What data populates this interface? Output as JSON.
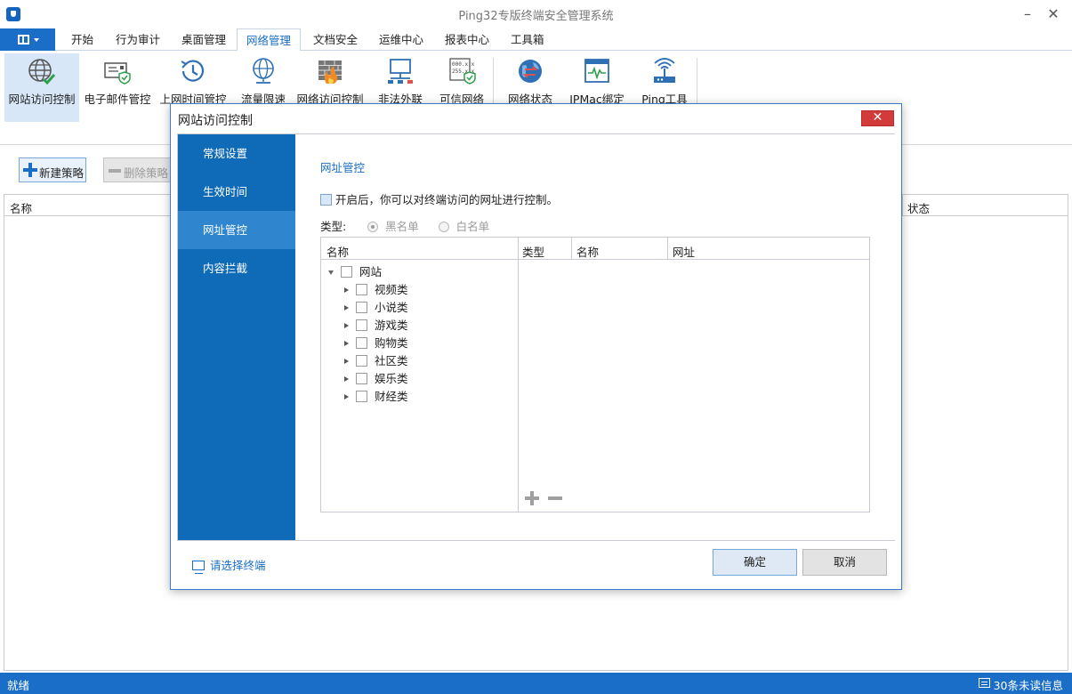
{
  "window": {
    "title": "Ping32专版终端安全管理系统",
    "minimize": "–",
    "close": "✕"
  },
  "menu": {
    "tabs": [
      {
        "label": "开始"
      },
      {
        "label": "行为审计"
      },
      {
        "label": "桌面管理"
      },
      {
        "label": "网络管理"
      },
      {
        "label": "文档安全"
      },
      {
        "label": "运维中心"
      },
      {
        "label": "报表中心"
      },
      {
        "label": "工具箱"
      }
    ],
    "active_tab": "网络管理"
  },
  "ribbon": {
    "items": [
      {
        "label": "网站访问控制",
        "icon": "globe-check-icon"
      },
      {
        "label": "电子邮件管控",
        "icon": "mail-shield-icon"
      },
      {
        "label": "上网时间管控",
        "icon": "clock-history-icon"
      },
      {
        "label": "流量限速",
        "icon": "globe-speed-icon"
      },
      {
        "label": "网络访问控制",
        "icon": "firewall-icon"
      },
      {
        "label": "非法外联",
        "icon": "network-monitor-icon"
      },
      {
        "label": "可信网络",
        "icon": "trusted-ip-icon"
      },
      {
        "label": "网络状态",
        "icon": "network-status-icon"
      },
      {
        "label": "IPMac绑定",
        "icon": "ipmac-bind-icon"
      },
      {
        "label": "Ping工具",
        "icon": "ping-tool-icon"
      }
    ],
    "active_item": "网站访问控制"
  },
  "toolbar": {
    "new_policy": "新建策略",
    "delete_policy": "删除策略"
  },
  "main_table": {
    "columns": [
      "名称",
      "状态"
    ]
  },
  "statusbar": {
    "left": "就绪",
    "right": "30条未读信息"
  },
  "dialog": {
    "title": "网站访问控制",
    "close": "✕",
    "sidebar": [
      {
        "label": "常规设置"
      },
      {
        "label": "生效时间"
      },
      {
        "label": "网址管控"
      },
      {
        "label": "内容拦截"
      }
    ],
    "active_section": "网址管控",
    "section_title": "网址管控",
    "enable_text": "开启后，你可以对终端访问的网址进行控制。",
    "type_label": "类型:",
    "type_options": [
      {
        "label": "黑名单",
        "selected": true
      },
      {
        "label": "白名单",
        "selected": false
      }
    ],
    "tree": {
      "header": "名称",
      "root": "网站",
      "children": [
        "视频类",
        "小说类",
        "游戏类",
        "购物类",
        "社区类",
        "娱乐类",
        "财经类"
      ]
    },
    "grid": {
      "columns": [
        "类型",
        "名称",
        "网址"
      ]
    },
    "select_terminal": "请选择终端",
    "ok": "确定",
    "cancel": "取消"
  }
}
